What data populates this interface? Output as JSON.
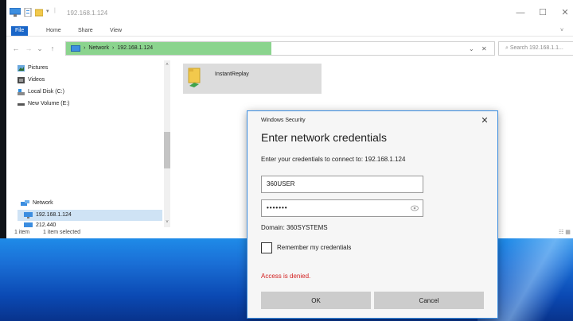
{
  "window": {
    "title": "192.168.1.124",
    "minimize_glyph": "—",
    "maximize_glyph": "☐",
    "close_glyph": "✕"
  },
  "ribbon": {
    "tabs": [
      "File",
      "Home",
      "Share",
      "View"
    ]
  },
  "address": {
    "crumbs": [
      "Network",
      "192.168.1.124"
    ],
    "separator": "›",
    "search_placeholder": "Search 192.168.1.1...",
    "back_glyph": "←",
    "forward_glyph": "→",
    "recent_glyph": "⌄",
    "up_glyph": "↑",
    "dropdown_glyph": "⌄",
    "close_glyph": "✕",
    "search_glyph": "⌕"
  },
  "nav": {
    "items": [
      {
        "label": "Pictures",
        "icon": "pictures-icon"
      },
      {
        "label": "Videos",
        "icon": "videos-icon"
      },
      {
        "label": "Local Disk (C:)",
        "icon": "local-disk-icon"
      },
      {
        "label": "New Volume (E:)",
        "icon": "drive-icon"
      }
    ],
    "network_label": "Network",
    "selected_label": "192.168.1.124",
    "partial_label": "212.440",
    "scroll_up_glyph": "˄",
    "scroll_down_glyph": "˅"
  },
  "content": {
    "folder_name": "InstantReplay"
  },
  "status": {
    "count": "1 item",
    "selected": "1 item selected",
    "view_glyphs": "☷ ▦"
  },
  "dialog": {
    "title": "Windows Security",
    "close_glyph": "✕",
    "heading": "Enter network credentials",
    "instruction": "Enter your credentials to connect to: 192.168.1.124",
    "username_value": "360USER",
    "password_value": "•••••••",
    "domain": "Domain: 360SYSTEMS",
    "remember_label": "Remember my credentials",
    "remember_checked": false,
    "error": "Access is denied.",
    "ok_label": "OK",
    "cancel_label": "Cancel",
    "error_color": "#d21f1f"
  },
  "colors": {
    "accent": "#1a66c8",
    "address_highlight": "#8bd48e",
    "dialog_border": "#3b8de0"
  }
}
